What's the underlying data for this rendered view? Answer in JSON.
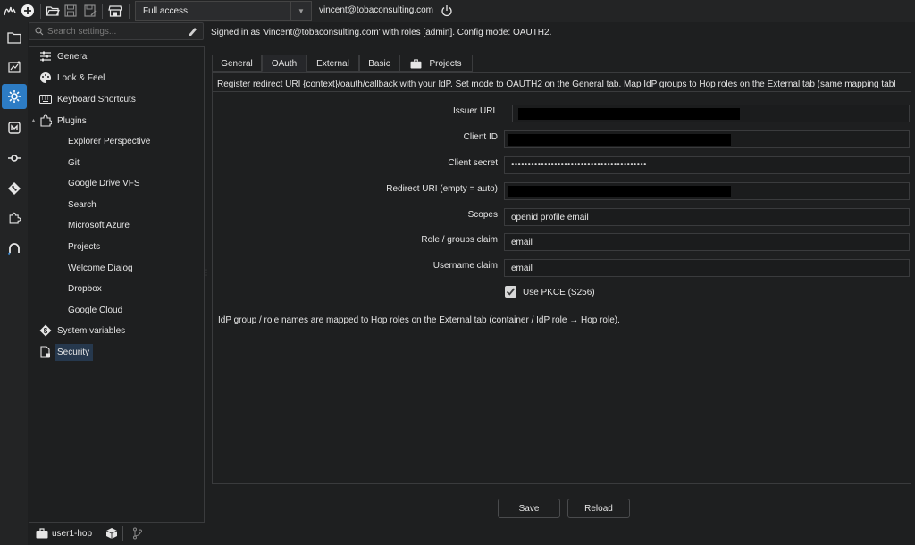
{
  "toolbar": {
    "access_mode": "Full access",
    "user_email": "vincent@tobaconsulting.com",
    "icons": [
      "hop-logo-icon",
      "add-icon",
      "open-folder-icon",
      "save-icon",
      "save-as-icon",
      "marketplace-icon",
      "power-icon"
    ]
  },
  "rail": {
    "icons": [
      "file-explorer-icon",
      "metadata-icon",
      "settings-icon",
      "monitor-icon",
      "git-icon",
      "git-branch-icon",
      "plugins-icon",
      "search-icon"
    ],
    "active": "settings-icon"
  },
  "search": {
    "placeholder": "Search settings..."
  },
  "tree": {
    "items": [
      {
        "label": "General",
        "icon": "sliders-icon"
      },
      {
        "label": "Look & Feel",
        "icon": "palette-icon"
      },
      {
        "label": "Keyboard Shortcuts",
        "icon": "keyboard-icon"
      },
      {
        "label": "Plugins",
        "icon": "puzzle-icon"
      },
      {
        "label": "Explorer Perspective"
      },
      {
        "label": "Git"
      },
      {
        "label": "Google Drive VFS"
      },
      {
        "label": "Search"
      },
      {
        "label": "Microsoft Azure"
      },
      {
        "label": "Projects"
      },
      {
        "label": "Welcome Dialog"
      },
      {
        "label": "Dropbox"
      },
      {
        "label": "Google Cloud"
      },
      {
        "label": "System variables",
        "icon": "variable-icon"
      },
      {
        "label": "Security",
        "icon": "document-lock-icon"
      }
    ],
    "selected": "Security"
  },
  "status": {
    "project": "user1-hop"
  },
  "main": {
    "signed_in_text": "Signed in as 'vincent@tobaconsulting.com' with roles [admin]. Config mode: OAUTH2.",
    "tabs": [
      {
        "label": "General"
      },
      {
        "label": "OAuth"
      },
      {
        "label": "External"
      },
      {
        "label": "Basic"
      },
      {
        "label": "Projects"
      }
    ],
    "active_tab": "OAuth",
    "info_text": "Register redirect URI {context}/oauth/callback with your IdP. Set mode to OAUTH2 on the General tab. Map IdP groups to Hop roles on the External tab (same mapping tabl",
    "fields": {
      "issuer_url": {
        "label": "Issuer URL",
        "value": ""
      },
      "client_id": {
        "label": "Client ID",
        "value": ""
      },
      "client_secret": {
        "label": "Client secret",
        "value": "•••••••••••••••••••••••••••••••••••••••••"
      },
      "redirect_uri": {
        "label": "Redirect URI (empty = auto)",
        "value": ""
      },
      "scopes": {
        "label": "Scopes",
        "value": "openid profile email"
      },
      "role_claim": {
        "label": "Role / groups claim",
        "value": "email"
      },
      "username_claim": {
        "label": "Username claim",
        "value": "email"
      }
    },
    "pkce": {
      "label": "Use PKCE (S256)",
      "checked": true
    },
    "mapping_note": "IdP group / role names are mapped to Hop roles on the External tab (container / IdP role → Hop role)."
  },
  "buttons": {
    "save": "Save",
    "reload": "Reload"
  }
}
